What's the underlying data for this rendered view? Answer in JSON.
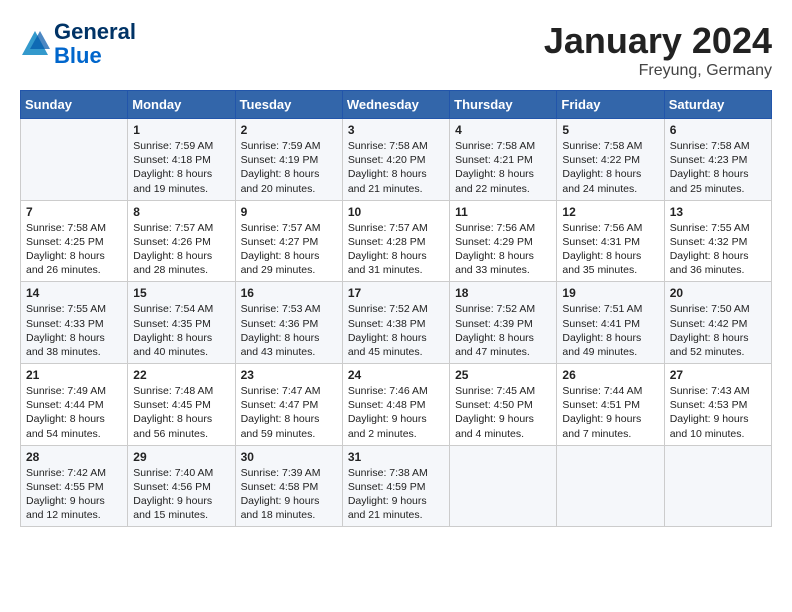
{
  "header": {
    "logo_general": "General",
    "logo_blue": "Blue",
    "month": "January 2024",
    "location": "Freyung, Germany"
  },
  "days_of_week": [
    "Sunday",
    "Monday",
    "Tuesday",
    "Wednesday",
    "Thursday",
    "Friday",
    "Saturday"
  ],
  "weeks": [
    [
      {
        "day": "",
        "sunrise": "",
        "sunset": "",
        "daylight": ""
      },
      {
        "day": "1",
        "sunrise": "Sunrise: 7:59 AM",
        "sunset": "Sunset: 4:18 PM",
        "daylight": "Daylight: 8 hours and 19 minutes."
      },
      {
        "day": "2",
        "sunrise": "Sunrise: 7:59 AM",
        "sunset": "Sunset: 4:19 PM",
        "daylight": "Daylight: 8 hours and 20 minutes."
      },
      {
        "day": "3",
        "sunrise": "Sunrise: 7:58 AM",
        "sunset": "Sunset: 4:20 PM",
        "daylight": "Daylight: 8 hours and 21 minutes."
      },
      {
        "day": "4",
        "sunrise": "Sunrise: 7:58 AM",
        "sunset": "Sunset: 4:21 PM",
        "daylight": "Daylight: 8 hours and 22 minutes."
      },
      {
        "day": "5",
        "sunrise": "Sunrise: 7:58 AM",
        "sunset": "Sunset: 4:22 PM",
        "daylight": "Daylight: 8 hours and 24 minutes."
      },
      {
        "day": "6",
        "sunrise": "Sunrise: 7:58 AM",
        "sunset": "Sunset: 4:23 PM",
        "daylight": "Daylight: 8 hours and 25 minutes."
      }
    ],
    [
      {
        "day": "7",
        "sunrise": "Sunrise: 7:58 AM",
        "sunset": "Sunset: 4:25 PM",
        "daylight": "Daylight: 8 hours and 26 minutes."
      },
      {
        "day": "8",
        "sunrise": "Sunrise: 7:57 AM",
        "sunset": "Sunset: 4:26 PM",
        "daylight": "Daylight: 8 hours and 28 minutes."
      },
      {
        "day": "9",
        "sunrise": "Sunrise: 7:57 AM",
        "sunset": "Sunset: 4:27 PM",
        "daylight": "Daylight: 8 hours and 29 minutes."
      },
      {
        "day": "10",
        "sunrise": "Sunrise: 7:57 AM",
        "sunset": "Sunset: 4:28 PM",
        "daylight": "Daylight: 8 hours and 31 minutes."
      },
      {
        "day": "11",
        "sunrise": "Sunrise: 7:56 AM",
        "sunset": "Sunset: 4:29 PM",
        "daylight": "Daylight: 8 hours and 33 minutes."
      },
      {
        "day": "12",
        "sunrise": "Sunrise: 7:56 AM",
        "sunset": "Sunset: 4:31 PM",
        "daylight": "Daylight: 8 hours and 35 minutes."
      },
      {
        "day": "13",
        "sunrise": "Sunrise: 7:55 AM",
        "sunset": "Sunset: 4:32 PM",
        "daylight": "Daylight: 8 hours and 36 minutes."
      }
    ],
    [
      {
        "day": "14",
        "sunrise": "Sunrise: 7:55 AM",
        "sunset": "Sunset: 4:33 PM",
        "daylight": "Daylight: 8 hours and 38 minutes."
      },
      {
        "day": "15",
        "sunrise": "Sunrise: 7:54 AM",
        "sunset": "Sunset: 4:35 PM",
        "daylight": "Daylight: 8 hours and 40 minutes."
      },
      {
        "day": "16",
        "sunrise": "Sunrise: 7:53 AM",
        "sunset": "Sunset: 4:36 PM",
        "daylight": "Daylight: 8 hours and 43 minutes."
      },
      {
        "day": "17",
        "sunrise": "Sunrise: 7:52 AM",
        "sunset": "Sunset: 4:38 PM",
        "daylight": "Daylight: 8 hours and 45 minutes."
      },
      {
        "day": "18",
        "sunrise": "Sunrise: 7:52 AM",
        "sunset": "Sunset: 4:39 PM",
        "daylight": "Daylight: 8 hours and 47 minutes."
      },
      {
        "day": "19",
        "sunrise": "Sunrise: 7:51 AM",
        "sunset": "Sunset: 4:41 PM",
        "daylight": "Daylight: 8 hours and 49 minutes."
      },
      {
        "day": "20",
        "sunrise": "Sunrise: 7:50 AM",
        "sunset": "Sunset: 4:42 PM",
        "daylight": "Daylight: 8 hours and 52 minutes."
      }
    ],
    [
      {
        "day": "21",
        "sunrise": "Sunrise: 7:49 AM",
        "sunset": "Sunset: 4:44 PM",
        "daylight": "Daylight: 8 hours and 54 minutes."
      },
      {
        "day": "22",
        "sunrise": "Sunrise: 7:48 AM",
        "sunset": "Sunset: 4:45 PM",
        "daylight": "Daylight: 8 hours and 56 minutes."
      },
      {
        "day": "23",
        "sunrise": "Sunrise: 7:47 AM",
        "sunset": "Sunset: 4:47 PM",
        "daylight": "Daylight: 8 hours and 59 minutes."
      },
      {
        "day": "24",
        "sunrise": "Sunrise: 7:46 AM",
        "sunset": "Sunset: 4:48 PM",
        "daylight": "Daylight: 9 hours and 2 minutes."
      },
      {
        "day": "25",
        "sunrise": "Sunrise: 7:45 AM",
        "sunset": "Sunset: 4:50 PM",
        "daylight": "Daylight: 9 hours and 4 minutes."
      },
      {
        "day": "26",
        "sunrise": "Sunrise: 7:44 AM",
        "sunset": "Sunset: 4:51 PM",
        "daylight": "Daylight: 9 hours and 7 minutes."
      },
      {
        "day": "27",
        "sunrise": "Sunrise: 7:43 AM",
        "sunset": "Sunset: 4:53 PM",
        "daylight": "Daylight: 9 hours and 10 minutes."
      }
    ],
    [
      {
        "day": "28",
        "sunrise": "Sunrise: 7:42 AM",
        "sunset": "Sunset: 4:55 PM",
        "daylight": "Daylight: 9 hours and 12 minutes."
      },
      {
        "day": "29",
        "sunrise": "Sunrise: 7:40 AM",
        "sunset": "Sunset: 4:56 PM",
        "daylight": "Daylight: 9 hours and 15 minutes."
      },
      {
        "day": "30",
        "sunrise": "Sunrise: 7:39 AM",
        "sunset": "Sunset: 4:58 PM",
        "daylight": "Daylight: 9 hours and 18 minutes."
      },
      {
        "day": "31",
        "sunrise": "Sunrise: 7:38 AM",
        "sunset": "Sunset: 4:59 PM",
        "daylight": "Daylight: 9 hours and 21 minutes."
      },
      {
        "day": "",
        "sunrise": "",
        "sunset": "",
        "daylight": ""
      },
      {
        "day": "",
        "sunrise": "",
        "sunset": "",
        "daylight": ""
      },
      {
        "day": "",
        "sunrise": "",
        "sunset": "",
        "daylight": ""
      }
    ]
  ]
}
